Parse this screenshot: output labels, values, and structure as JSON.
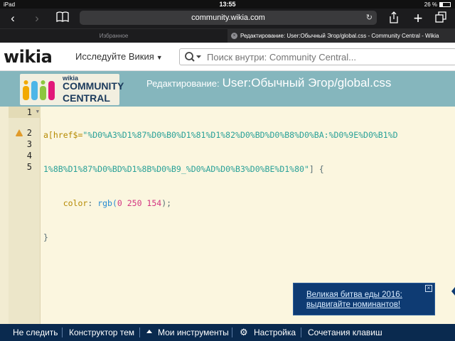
{
  "status_bar": {
    "device": "iPad",
    "time": "13:55",
    "battery_text": "26 %",
    "battery_level": 0.26
  },
  "safari": {
    "url": "community.wikia.com",
    "favorites_label": "Избранное",
    "active_tab_title": "Редактирование: User:Обычный Эгор/global.css - Community Central - Wikia"
  },
  "wikia_header": {
    "logo_text": "wikia",
    "explore_label": "Исследуйте Викия",
    "search_placeholder": "Поиск внутри: Community Central..."
  },
  "edit_header": {
    "logo_line1": "wikia",
    "logo_line2": "COMMUNITY",
    "logo_line3": "CENTRAL",
    "title_prefix": "Редактирование:",
    "page_name": "User:Обычный Эгор/global.css"
  },
  "editor": {
    "line_numbers": [
      "1",
      "2",
      "3",
      "4",
      "5"
    ],
    "warning_lines": [
      1,
      2
    ],
    "code": {
      "line1a_sel": "a[href$=",
      "line1a_str": "\"%D0%A3%D1%87%D0%B0%D1%81%D1%82%D0%BD%D0%B8%D0%BA:%D0%9E%D0%B1%D",
      "line1b_str": "1%8B%D1%87%D0%BD%D1%8B%D0%B9_%D0%AD%D0%B3%D0%BE%D1%80\"",
      "line1b_rest": "] {",
      "line2_prop": "color",
      "line2_colon": ": ",
      "line2_fn": "rgb(",
      "line2_num": "0 250 154",
      "line2_end": ");",
      "line3": "}"
    }
  },
  "notification": {
    "text": "Великая битва еды 2016: выдвигайте номинантов!",
    "close_label": "×"
  },
  "bottom_bar": {
    "unfollow": "Не следить",
    "theme_designer": "Конструктор тем",
    "my_tools": "Мои инструменты",
    "settings": "Настройка",
    "shortcuts": "Сочетания клавиш"
  },
  "colors": {
    "accent_header": "#85b6bd",
    "bottom_bar": "#0a2a4f",
    "notification_bg": "#0e3b73",
    "editor_bg": "#fbf6df",
    "warning": "#e09a2a"
  }
}
